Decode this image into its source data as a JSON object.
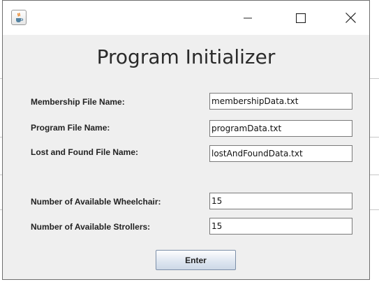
{
  "window": {
    "title": "Program Initializer"
  },
  "form": {
    "membership_label": "Membership File Name:",
    "membership_value": "membershipData.txt",
    "program_label": "Program File Name:",
    "program_value": "programData.txt",
    "lost_found_label": "Lost and Found File Name:",
    "lost_found_value": "lostAndFoundData.txt",
    "wheelchair_label": "Number of Available Wheelchair:",
    "wheelchair_value": "15",
    "strollers_label": "Number of Available Strollers:",
    "strollers_value": "15",
    "enter_label": "Enter"
  },
  "icons": {
    "app": "java-coffee-icon",
    "minimize": "minimize-icon",
    "maximize": "maximize-icon",
    "close": "close-icon"
  }
}
